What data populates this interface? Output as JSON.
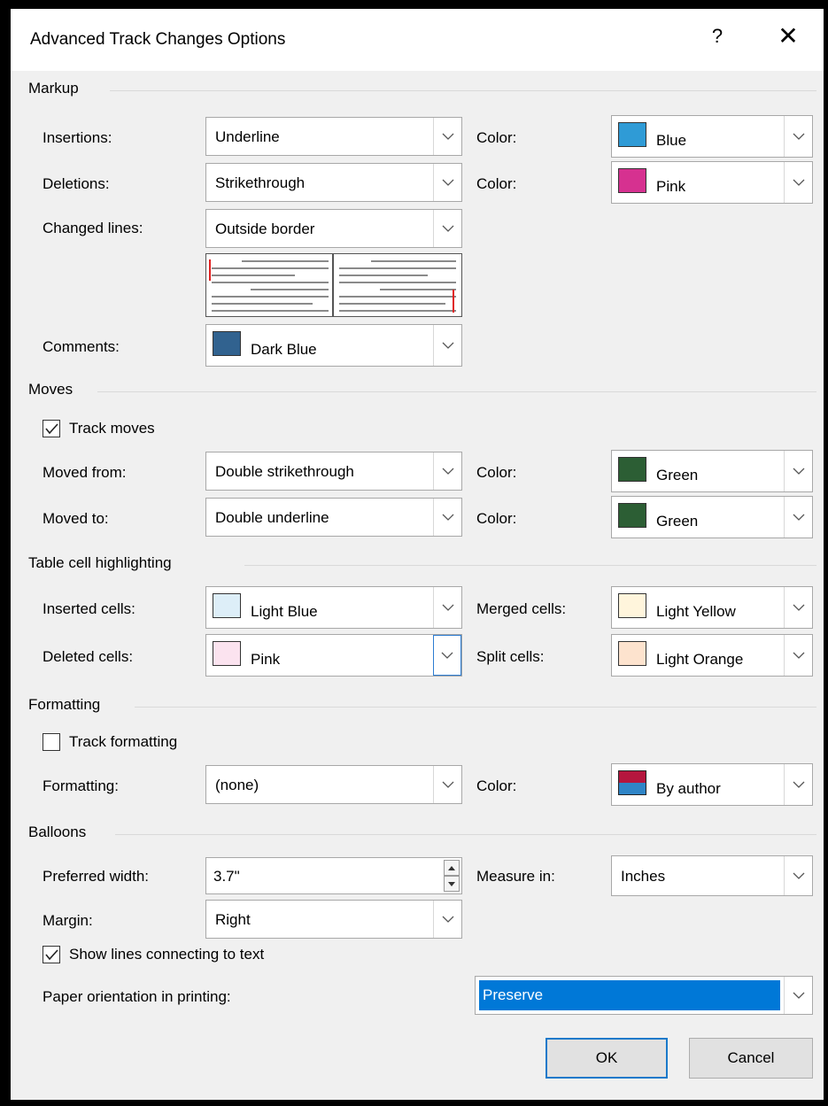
{
  "dialog": {
    "title": "Advanced Track Changes Options",
    "help_label": "?",
    "close_label": "✕"
  },
  "markup": {
    "heading": "Markup",
    "insertions": {
      "label": "Insertions:",
      "value": "Underline",
      "color_label": "Color:",
      "color_value": "Blue",
      "swatch": "#2f9bd6"
    },
    "deletions": {
      "label": "Deletions:",
      "value": "Strikethrough",
      "color_label": "Color:",
      "color_value": "Pink",
      "swatch": "#d63190"
    },
    "changed_lines": {
      "label": "Changed lines:",
      "value": "Outside border",
      "marker_color": "#e02020"
    },
    "comments": {
      "label": "Comments:",
      "value": "Dark Blue",
      "swatch": "#31628f"
    }
  },
  "moves": {
    "heading": "Moves",
    "track_moves": {
      "label": "Track moves",
      "checked": true
    },
    "moved_from": {
      "label": "Moved from:",
      "value": "Double strikethrough",
      "color_label": "Color:",
      "color_value": "Green",
      "swatch": "#2c5e34"
    },
    "moved_to": {
      "label": "Moved to:",
      "value": "Double underline",
      "color_label": "Color:",
      "color_value": "Green",
      "swatch": "#2c5e34"
    }
  },
  "table_cells": {
    "heading": "Table cell highlighting",
    "inserted": {
      "label": "Inserted cells:",
      "value": "Light Blue",
      "swatch": "#ddeef8"
    },
    "deleted": {
      "label": "Deleted cells:",
      "value": "Pink",
      "swatch": "#fbe3ef"
    },
    "merged": {
      "label": "Merged cells:",
      "value": "Light Yellow",
      "swatch": "#fff5dc"
    },
    "split": {
      "label": "Split cells:",
      "value": "Light Orange",
      "swatch": "#fde3ce"
    }
  },
  "formatting": {
    "heading": "Formatting",
    "track_formatting": {
      "label": "Track formatting",
      "checked": false
    },
    "formatting": {
      "label": "Formatting:",
      "value": "(none)",
      "color_label": "Color:",
      "color_value": "By author",
      "swatch_top": "#b5163e",
      "swatch_bottom": "#2f85c7"
    }
  },
  "balloons": {
    "heading": "Balloons",
    "preferred_width": {
      "label": "Preferred width:",
      "value": "3.7\""
    },
    "measure_in": {
      "label": "Measure in:",
      "value": "Inches"
    },
    "margin": {
      "label": "Margin:",
      "value": "Right"
    },
    "show_lines": {
      "label": "Show lines connecting to text",
      "checked": true
    },
    "paper_orientation": {
      "label": "Paper orientation in printing:",
      "value": "Preserve",
      "highlight": "#0078d7"
    }
  },
  "buttons": {
    "ok": "OK",
    "cancel": "Cancel"
  },
  "icons": {
    "chevron": "chevron-down-icon",
    "check": "checkmark-icon",
    "close": "close-icon",
    "help": "help-icon"
  }
}
